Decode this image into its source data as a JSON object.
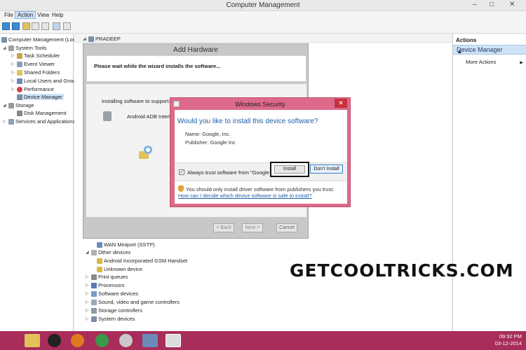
{
  "window": {
    "title": "Computer Management",
    "min": "–",
    "max": "□",
    "close": "✕"
  },
  "menu": [
    "File",
    "Action",
    "View",
    "Help"
  ],
  "tree": {
    "root": "Computer Management (Local",
    "system_tools": "System Tools",
    "task_scheduler": "Task Scheduler",
    "event_viewer": "Event Viewer",
    "shared_folders": "Shared Folders",
    "local_users": "Local Users and Groups",
    "performance": "Performance",
    "device_manager": "Device Manager",
    "storage": "Storage",
    "disk_management": "Disk Management",
    "services": "Services and Applications"
  },
  "mid": {
    "computer_name": "PRADEEP"
  },
  "devices": {
    "wan": "WAN Miniport (SSTP)",
    "other_devices": "Other devices",
    "android_gsm": "Android Incorporated GSM Handset",
    "unknown": "Unknown device",
    "print_queues": "Print queues",
    "processors": "Processors",
    "software_devices": "Software devices",
    "sound": "Sound, video and game controllers",
    "storage_controllers": "Storage controllers",
    "system_devices": "System devices"
  },
  "actions": {
    "header": "Actions",
    "section": "Device Manager",
    "more": "More Actions"
  },
  "wizard": {
    "title": "Add Hardware",
    "banner": "Please wait while the wizard installs the software...",
    "installing_label": "Installing software to support:",
    "device": "Android ADB Interfac",
    "back": "< Back",
    "next": "Next >",
    "cancel": "Cancel"
  },
  "security": {
    "title": "Windows Security",
    "close": "✕",
    "question": "Would you like to install this device software?",
    "name": "Name: Google, Inc.",
    "publisher": "Publisher: Google Inc",
    "trust_check": "✓",
    "trust": "Always trust software from \"Google Inc\".",
    "install": "Install",
    "dont_install": "Don't Install",
    "warning": "You should only install driver software from publishers you trust.",
    "link": "How can I decide which device software is safe to install?"
  },
  "watermark": "GETCOOLTRICKS.COM",
  "clock": {
    "time": "09:32 PM",
    "date": "03-12-2014"
  }
}
